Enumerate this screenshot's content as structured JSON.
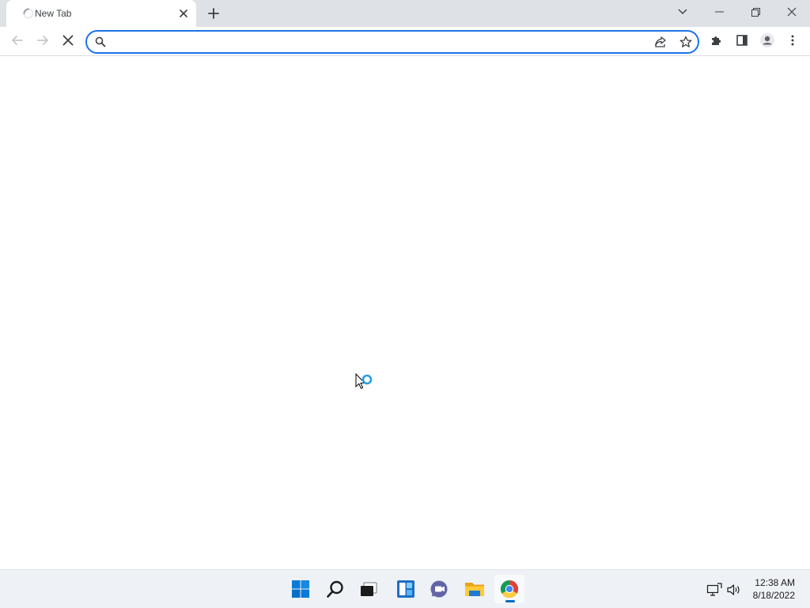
{
  "browser": {
    "tab": {
      "title": "New Tab",
      "loading": true
    },
    "omnibox": {
      "value": "",
      "placeholder": ""
    },
    "accent_color": "#1a73e8"
  },
  "taskbar": {
    "pinned": [
      "start-icon",
      "search-icon",
      "task-view-icon",
      "widgets-icon",
      "teams-chat-icon",
      "file-explorer-icon",
      "chrome-icon"
    ],
    "active": "chrome-icon",
    "clock": {
      "time": "12:38 AM",
      "date": "8/18/2022"
    }
  }
}
